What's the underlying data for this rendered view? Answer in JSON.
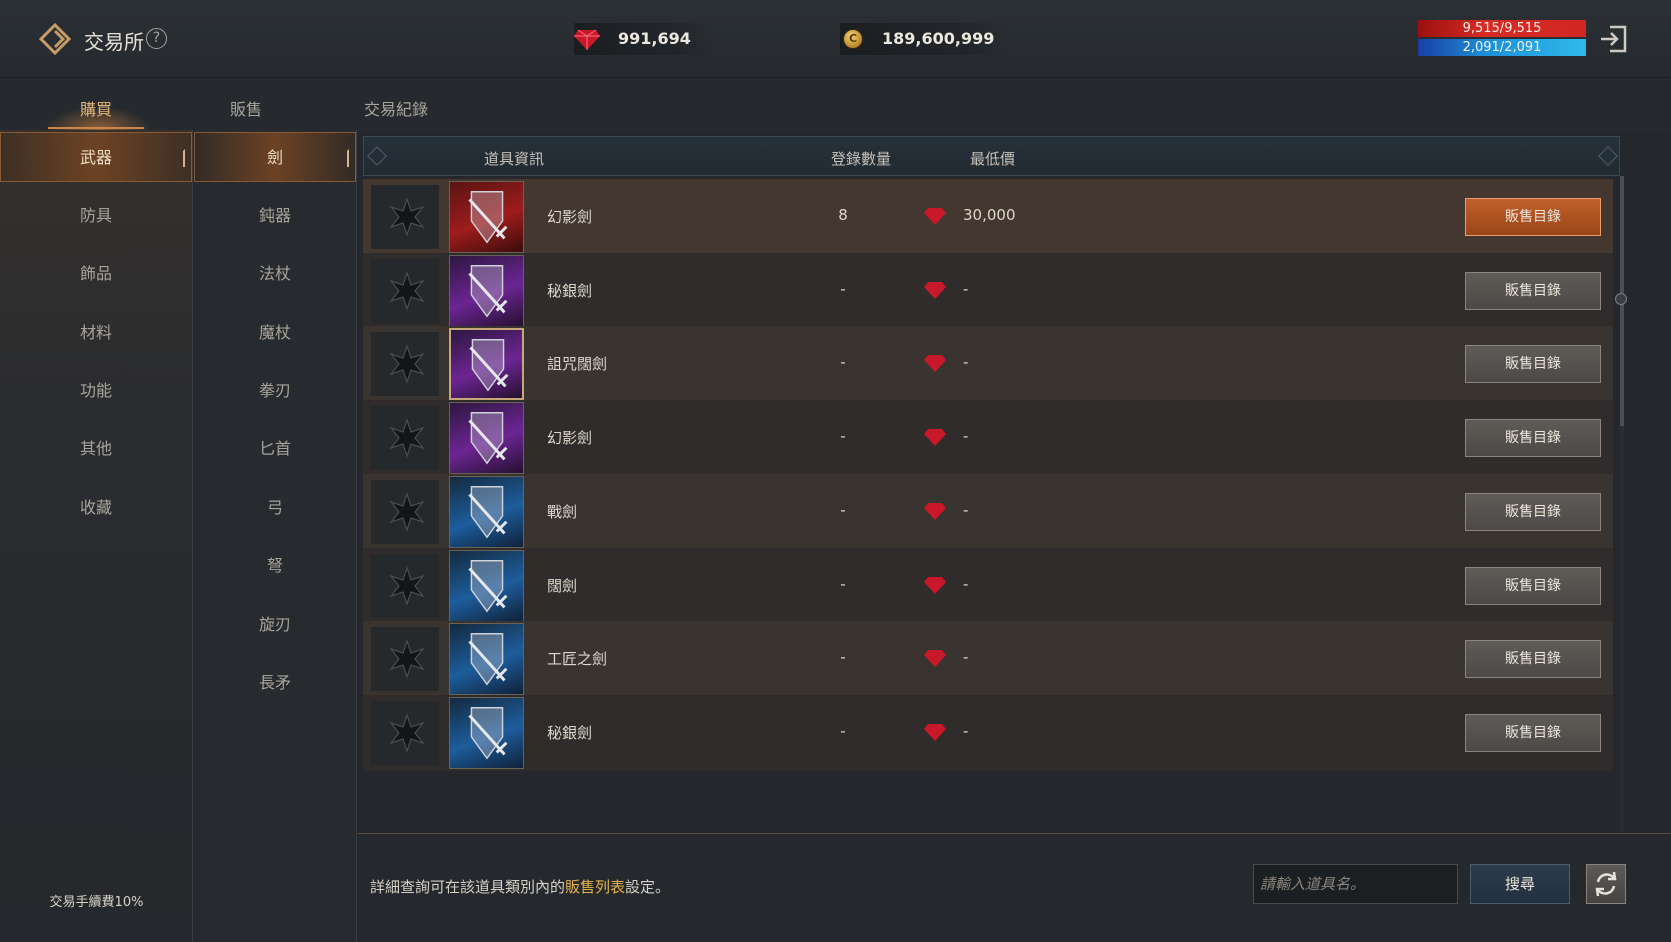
{
  "header": {
    "title": "交易所",
    "help_label": "?",
    "ruby_amount": "991,694",
    "gold_amount": "189,600,999",
    "hp_text": "9,515/9,515",
    "mp_text": "2,091/2,091"
  },
  "tabs": [
    {
      "label": "購買",
      "active": true
    },
    {
      "label": "販售",
      "active": false
    },
    {
      "label": "交易紀錄",
      "active": false
    }
  ],
  "categories": [
    {
      "label": "武器",
      "active": true
    },
    {
      "label": "防具",
      "active": false
    },
    {
      "label": "飾品",
      "active": false
    },
    {
      "label": "材料",
      "active": false
    },
    {
      "label": "功能",
      "active": false
    },
    {
      "label": "其他",
      "active": false
    },
    {
      "label": "收藏",
      "active": false
    }
  ],
  "subcategories": [
    {
      "label": "劍",
      "active": true
    },
    {
      "label": "鈍器",
      "active": false
    },
    {
      "label": "法杖",
      "active": false
    },
    {
      "label": "魔杖",
      "active": false
    },
    {
      "label": "拳刃",
      "active": false
    },
    {
      "label": "匕首",
      "active": false
    },
    {
      "label": "弓",
      "active": false
    },
    {
      "label": "弩",
      "active": false
    },
    {
      "label": "旋刃",
      "active": false
    },
    {
      "label": "長矛",
      "active": false
    }
  ],
  "fee_text": "交易手續費10%",
  "list": {
    "headers": {
      "info": "道具資訊",
      "count": "登錄數量",
      "min_price": "最低價"
    },
    "rows": [
      {
        "name": "幻影劍",
        "count": "8",
        "price": "30,000",
        "grade": "red"
      },
      {
        "name": "秘銀劍",
        "count": "-",
        "price": "-",
        "grade": "purple"
      },
      {
        "name": "詛咒闊劍",
        "count": "-",
        "price": "-",
        "grade": "purple"
      },
      {
        "name": "幻影劍",
        "count": "-",
        "price": "-",
        "grade": "purple"
      },
      {
        "name": "戰劍",
        "count": "-",
        "price": "-",
        "grade": "blue"
      },
      {
        "name": "闊劍",
        "count": "-",
        "price": "-",
        "grade": "blue"
      },
      {
        "name": "工匠之劍",
        "count": "-",
        "price": "-",
        "grade": "blue"
      },
      {
        "name": "秘銀劍",
        "count": "-",
        "price": "-",
        "grade": "blue"
      }
    ],
    "sell_button_label": "販售目錄"
  },
  "footer": {
    "hint_before": "詳細查詢可在該道具類別內的",
    "hint_link": "販售列表",
    "hint_after": "設定。",
    "search_placeholder": "請輸入道具名。",
    "search_button": "搜尋"
  },
  "colors": {
    "accent": "#c9864a",
    "hot_button": "#b05625",
    "link": "#e3b24a",
    "hp": "#d12622",
    "mp": "#1d8fd8"
  }
}
